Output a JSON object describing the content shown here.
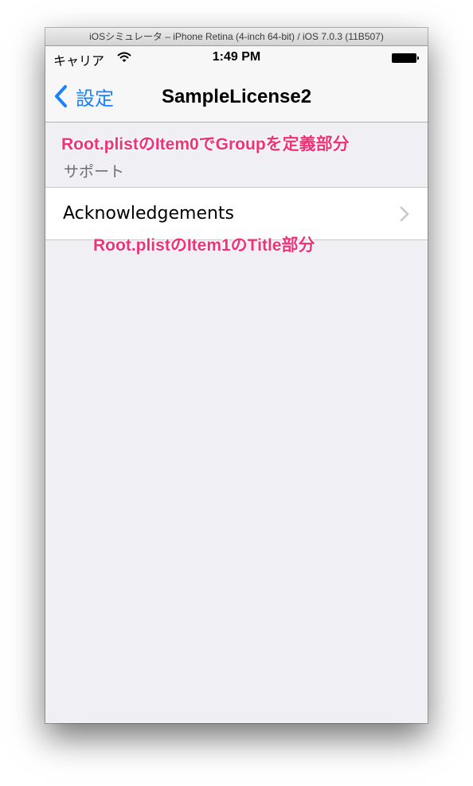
{
  "window": {
    "title": "iOSシミュレータ – iPhone Retina (4-inch 64-bit) / iOS 7.0.3 (11B507)"
  },
  "status_bar": {
    "carrier": "キャリア",
    "time": "1:49 PM",
    "wifi_icon": "wifi-icon",
    "battery_icon": "battery-icon"
  },
  "nav_bar": {
    "back_label": "設定",
    "title": "SampleLicense2",
    "back_icon": "chevron-left-icon",
    "accent_color": "#1a82fb"
  },
  "settings": {
    "group_header": "サポート",
    "rows": [
      {
        "label": "Acknowledgements",
        "icon": "chevron-right-icon"
      }
    ]
  },
  "annotations": {
    "group_note": "Root.plistのItem0でGroupを定義部分",
    "title_note": "Root.plistのItem1のTitle部分",
    "color": "#ee3377"
  }
}
